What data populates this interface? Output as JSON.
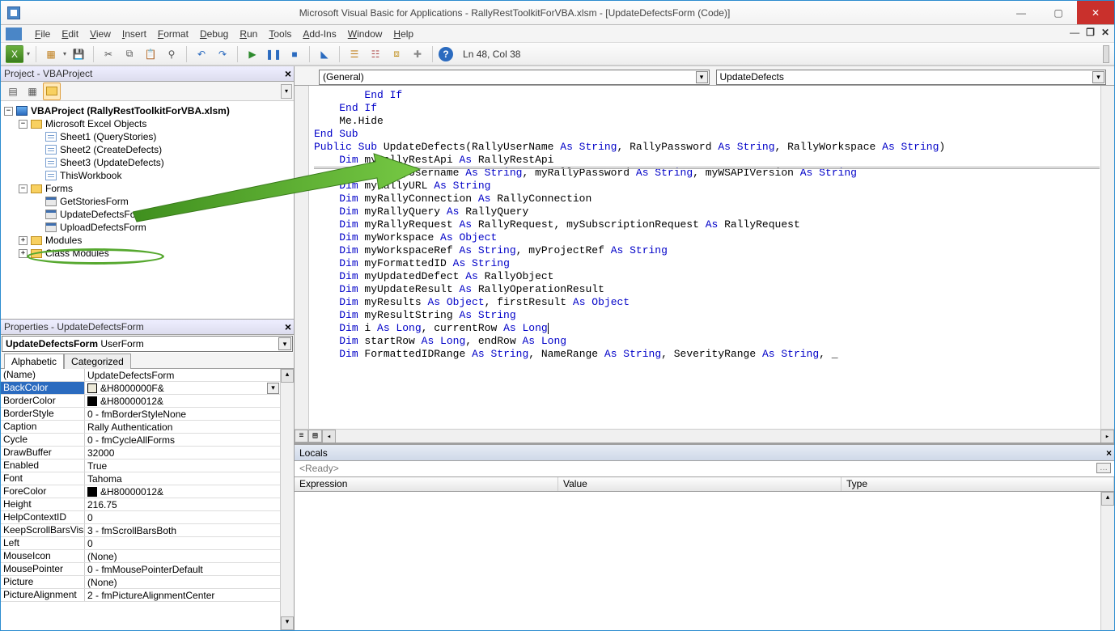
{
  "window": {
    "title": "Microsoft Visual Basic for Applications - RallyRestToolkitForVBA.xlsm - [UpdateDefectsForm (Code)]"
  },
  "menus": [
    "File",
    "Edit",
    "View",
    "Insert",
    "Format",
    "Debug",
    "Run",
    "Tools",
    "Add-Ins",
    "Window",
    "Help"
  ],
  "cursor_pos": "Ln 48, Col 38",
  "project_panel": {
    "title": "Project - VBAProject",
    "root": "VBAProject (RallyRestToolkitForVBA.xlsm)",
    "folders": {
      "excel_objects": "Microsoft Excel Objects",
      "sheets": [
        "Sheet1 (QueryStories)",
        "Sheet2 (CreateDefects)",
        "Sheet3 (UpdateDefects)",
        "ThisWorkbook"
      ],
      "forms": "Forms",
      "form_items": [
        "GetStoriesForm",
        "UpdateDefectsForm",
        "UploadDefectsForm"
      ],
      "modules": "Modules",
      "class_modules": "Class Modules"
    }
  },
  "properties_panel": {
    "title": "Properties - UpdateDefectsForm",
    "object_name": "UpdateDefectsForm",
    "object_type": "UserForm",
    "tabs": [
      "Alphabetic",
      "Categorized"
    ],
    "rows": [
      {
        "k": "(Name)",
        "v": "UpdateDefectsForm"
      },
      {
        "k": "BackColor",
        "v": "&H8000000F&",
        "swatch": "#ece9d8",
        "dd": true,
        "sel": true
      },
      {
        "k": "BorderColor",
        "v": "&H80000012&",
        "swatch": "#000000"
      },
      {
        "k": "BorderStyle",
        "v": "0 - fmBorderStyleNone"
      },
      {
        "k": "Caption",
        "v": "Rally Authentication"
      },
      {
        "k": "Cycle",
        "v": "0 - fmCycleAllForms"
      },
      {
        "k": "DrawBuffer",
        "v": "32000"
      },
      {
        "k": "Enabled",
        "v": "True"
      },
      {
        "k": "Font",
        "v": "Tahoma"
      },
      {
        "k": "ForeColor",
        "v": "&H80000012&",
        "swatch": "#000000"
      },
      {
        "k": "Height",
        "v": "216.75"
      },
      {
        "k": "HelpContextID",
        "v": "0"
      },
      {
        "k": "KeepScrollBarsVisible",
        "v": "3 - fmScrollBarsBoth"
      },
      {
        "k": "Left",
        "v": "0"
      },
      {
        "k": "MouseIcon",
        "v": "(None)"
      },
      {
        "k": "MousePointer",
        "v": "0 - fmMousePointerDefault"
      },
      {
        "k": "Picture",
        "v": "(None)"
      },
      {
        "k": "PictureAlignment",
        "v": "2 - fmPictureAlignmentCenter"
      }
    ]
  },
  "code": {
    "object_dd": "(General)",
    "proc_dd": "UpdateDefects",
    "lines": [
      {
        "indent": 8,
        "tokens": [
          {
            "t": "End If",
            "kw": true
          }
        ]
      },
      {
        "indent": 4,
        "tokens": [
          {
            "t": "End If",
            "kw": true
          }
        ]
      },
      {
        "indent": 0,
        "tokens": []
      },
      {
        "indent": 4,
        "tokens": [
          {
            "t": "Me.Hide"
          }
        ]
      },
      {
        "indent": 0,
        "tokens": []
      },
      {
        "indent": 0,
        "tokens": [
          {
            "t": "End Sub",
            "kw": true
          }
        ],
        "hr": true
      },
      {
        "indent": 0,
        "tokens": [
          {
            "t": "Public Sub",
            "kw": true
          },
          {
            "t": " UpdateDefects(RallyUserName "
          },
          {
            "t": "As String",
            "kw": true
          },
          {
            "t": ", RallyPassword "
          },
          {
            "t": "As String",
            "kw": true
          },
          {
            "t": ", RallyWorkspace "
          },
          {
            "t": "As String",
            "kw": true
          },
          {
            "t": ")"
          }
        ],
        "hrTop": true
      },
      {
        "indent": 0,
        "tokens": []
      },
      {
        "indent": 4,
        "tokens": [
          {
            "t": "Dim",
            "kw": true
          },
          {
            "t": " myRallyRestApi "
          },
          {
            "t": "As",
            "kw": true
          },
          {
            "t": " RallyRestApi"
          }
        ]
      },
      {
        "indent": 4,
        "tokens": [
          {
            "t": "Dim",
            "kw": true
          },
          {
            "t": " myRallyUsername "
          },
          {
            "t": "As String",
            "kw": true
          },
          {
            "t": ", myRallyPassword "
          },
          {
            "t": "As String",
            "kw": true
          },
          {
            "t": ", myWSAPIVersion "
          },
          {
            "t": "As String",
            "kw": true
          }
        ]
      },
      {
        "indent": 4,
        "tokens": [
          {
            "t": "Dim",
            "kw": true
          },
          {
            "t": " myRallyURL "
          },
          {
            "t": "As String",
            "kw": true
          }
        ]
      },
      {
        "indent": 4,
        "tokens": [
          {
            "t": "Dim",
            "kw": true
          },
          {
            "t": " myRallyConnection "
          },
          {
            "t": "As",
            "kw": true
          },
          {
            "t": " RallyConnection"
          }
        ]
      },
      {
        "indent": 4,
        "tokens": [
          {
            "t": "Dim",
            "kw": true
          },
          {
            "t": " myRallyQuery "
          },
          {
            "t": "As",
            "kw": true
          },
          {
            "t": " RallyQuery"
          }
        ]
      },
      {
        "indent": 4,
        "tokens": [
          {
            "t": "Dim",
            "kw": true
          },
          {
            "t": " myRallyRequest "
          },
          {
            "t": "As",
            "kw": true
          },
          {
            "t": " RallyRequest, mySubscriptionRequest "
          },
          {
            "t": "As",
            "kw": true
          },
          {
            "t": " RallyRequest"
          }
        ]
      },
      {
        "indent": 4,
        "tokens": [
          {
            "t": "Dim",
            "kw": true
          },
          {
            "t": " myWorkspace "
          },
          {
            "t": "As Object",
            "kw": true
          }
        ]
      },
      {
        "indent": 4,
        "tokens": [
          {
            "t": "Dim",
            "kw": true
          },
          {
            "t": " myWorkspaceRef "
          },
          {
            "t": "As String",
            "kw": true
          },
          {
            "t": ", myProjectRef "
          },
          {
            "t": "As String",
            "kw": true
          }
        ]
      },
      {
        "indent": 4,
        "tokens": [
          {
            "t": "Dim",
            "kw": true
          },
          {
            "t": " myFormattedID "
          },
          {
            "t": "As String",
            "kw": true
          }
        ]
      },
      {
        "indent": 4,
        "tokens": [
          {
            "t": "Dim",
            "kw": true
          },
          {
            "t": " myUpdatedDefect "
          },
          {
            "t": "As",
            "kw": true
          },
          {
            "t": " RallyObject"
          }
        ]
      },
      {
        "indent": 4,
        "tokens": [
          {
            "t": "Dim",
            "kw": true
          },
          {
            "t": " myUpdateResult "
          },
          {
            "t": "As",
            "kw": true
          },
          {
            "t": " RallyOperationResult"
          }
        ]
      },
      {
        "indent": 4,
        "tokens": [
          {
            "t": "Dim",
            "kw": true
          },
          {
            "t": " myResults "
          },
          {
            "t": "As Object",
            "kw": true
          },
          {
            "t": ", firstResult "
          },
          {
            "t": "As Object",
            "kw": true
          }
        ]
      },
      {
        "indent": 4,
        "tokens": [
          {
            "t": "Dim",
            "kw": true
          },
          {
            "t": " myResultString "
          },
          {
            "t": "As String",
            "kw": true
          }
        ]
      },
      {
        "indent": 4,
        "tokens": [
          {
            "t": "Dim",
            "kw": true
          },
          {
            "t": " i "
          },
          {
            "t": "As Long",
            "kw": true
          },
          {
            "t": ", currentRow "
          },
          {
            "t": "As Long",
            "kw": true
          }
        ],
        "caret": true
      },
      {
        "indent": 4,
        "tokens": [
          {
            "t": "Dim",
            "kw": true
          },
          {
            "t": " startRow "
          },
          {
            "t": "As Long",
            "kw": true
          },
          {
            "t": ", endRow "
          },
          {
            "t": "As Long",
            "kw": true
          }
        ]
      },
      {
        "indent": 4,
        "tokens": [
          {
            "t": "Dim",
            "kw": true
          },
          {
            "t": " FormattedIDRange "
          },
          {
            "t": "As String",
            "kw": true
          },
          {
            "t": ", NameRange "
          },
          {
            "t": "As String",
            "kw": true
          },
          {
            "t": ", SeverityRange "
          },
          {
            "t": "As String",
            "kw": true
          },
          {
            "t": ", _"
          }
        ]
      }
    ]
  },
  "locals": {
    "title": "Locals",
    "ready": "<Ready>",
    "cols": [
      "Expression",
      "Value",
      "Type"
    ]
  }
}
